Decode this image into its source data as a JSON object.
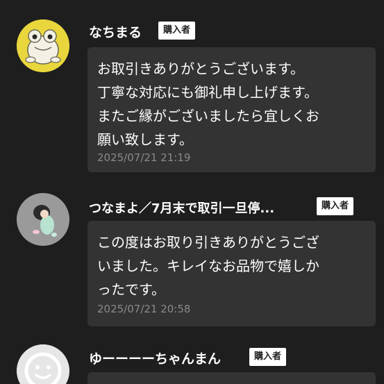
{
  "comments": [
    {
      "username": "なちまる",
      "badge": "購入者",
      "avatar_icon": "frog-illustration-avatar",
      "message_lines": [
        "お取引きありがとうございます。",
        "丁寧な対応にも御礼申し上げます。",
        "またご縁がございましたら宜しくお",
        "願い致します。"
      ],
      "timestamp": "2025/07/21 21:19"
    },
    {
      "username": "つなまよ／7月末で取引一旦停...",
      "badge": "購入者",
      "avatar_icon": "figure-photo-avatar",
      "message_lines": [
        "この度はお取り引きありがとうござ",
        "いました。キレイなお品物で嬉しか",
        "ったです。"
      ],
      "timestamp": "2025/07/21 20:58"
    },
    {
      "username": "ゆーーーーちゃんまん",
      "badge": "購入者",
      "avatar_icon": "default-person-avatar",
      "message_lines": [],
      "timestamp": ""
    }
  ],
  "colors": {
    "background": "#1e1e1e",
    "bubble": "#333333",
    "timestamp": "#8a8a8a",
    "badge_bg": "#ffffff"
  }
}
